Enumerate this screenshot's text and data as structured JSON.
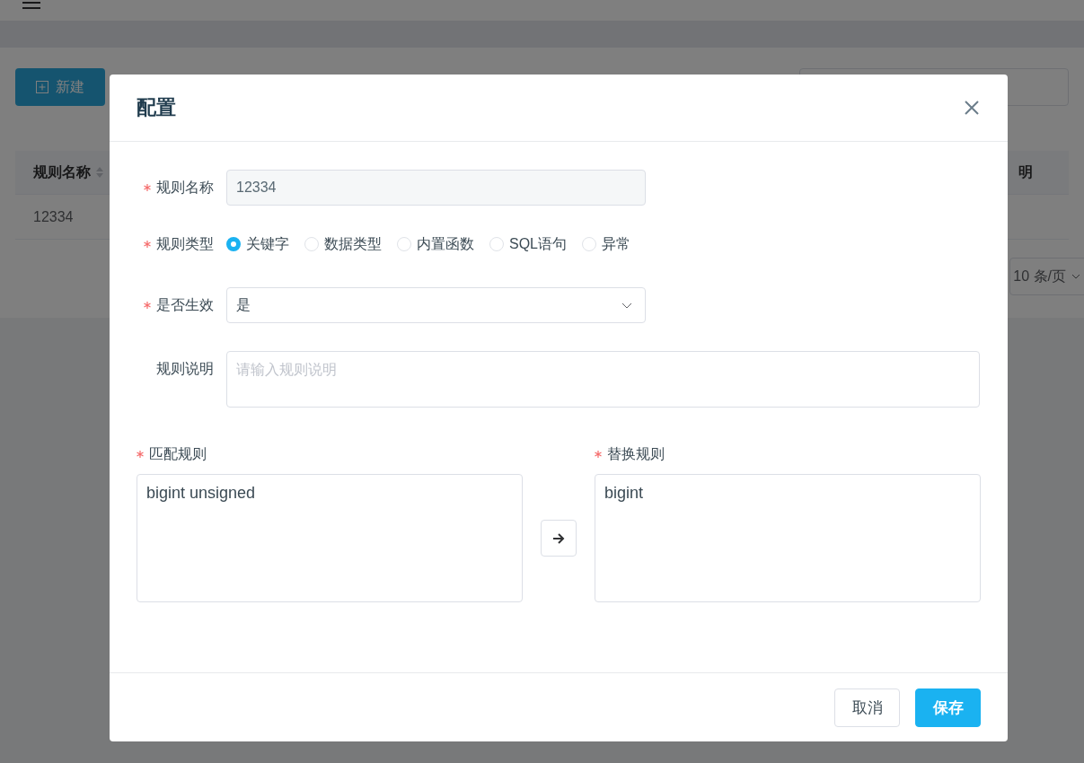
{
  "toolbar": {
    "new_button": "新建"
  },
  "table": {
    "columns": [
      {
        "label": "规则名称",
        "sortable": true
      },
      {
        "label": "明",
        "sortable": false
      }
    ],
    "rows": [
      [
        "12334"
      ]
    ]
  },
  "pagination": {
    "page_size": "10 条/页"
  },
  "dialog": {
    "title": "配置",
    "name": {
      "label": "规则名称",
      "required": true,
      "value": "12334",
      "disabled": true
    },
    "type": {
      "label": "规则类型",
      "required": true,
      "options": [
        {
          "label": "关键字",
          "selected": true
        },
        {
          "label": "数据类型",
          "selected": false
        },
        {
          "label": "内置函数",
          "selected": false
        },
        {
          "label": "SQL语句",
          "selected": false
        },
        {
          "label": "异常",
          "selected": false
        }
      ]
    },
    "enabled": {
      "label": "是否生效",
      "required": true,
      "value": "是"
    },
    "description": {
      "label": "规则说明",
      "required": false,
      "placeholder": "请输入规则说明"
    },
    "match": {
      "label": "匹配规则",
      "required": true,
      "value": "bigint unsigned"
    },
    "replace": {
      "label": "替换规则",
      "required": true,
      "value": "bigint"
    },
    "cancel_button": "取消",
    "save_button": "保存"
  }
}
